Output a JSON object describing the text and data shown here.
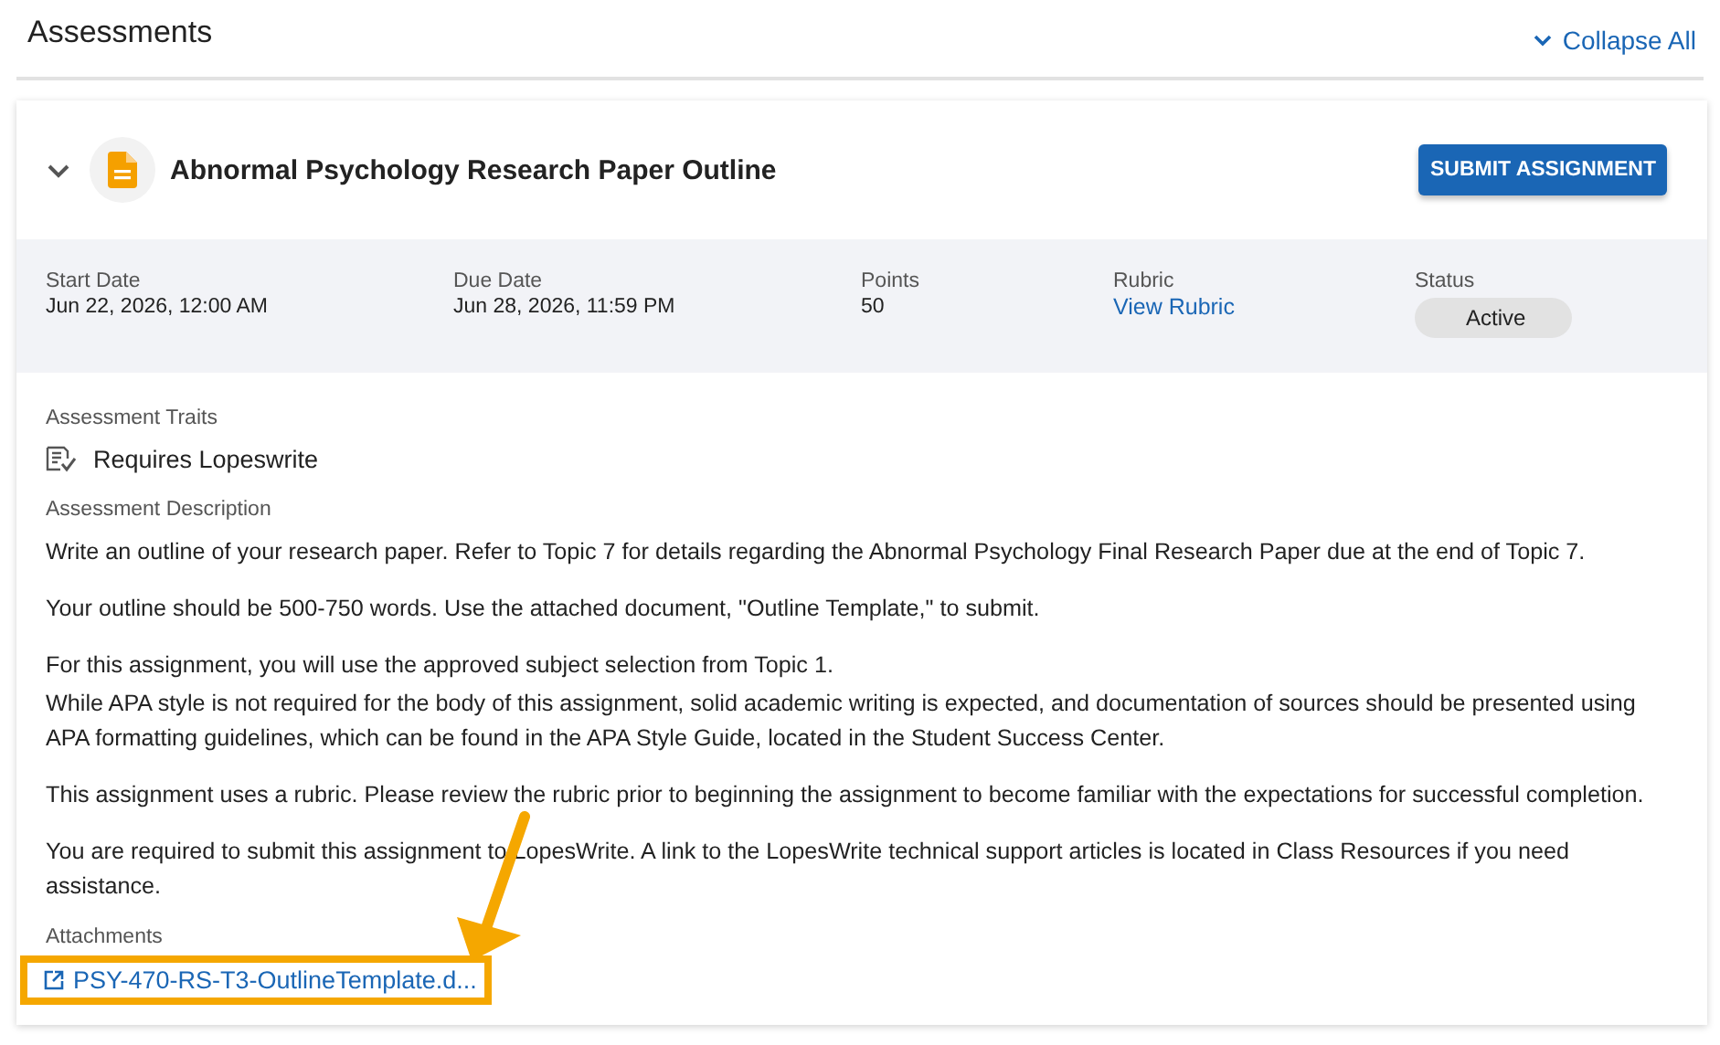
{
  "page": {
    "title": "Assessments",
    "collapse_all": "Collapse All"
  },
  "assessment": {
    "expanded": true,
    "title": "Abnormal Psychology Research Paper Outline",
    "submit_button": "SUBMIT ASSIGNMENT",
    "info": [
      {
        "label": "Start Date",
        "value": "Jun 22, 2026, 12:00 AM",
        "kind": "text"
      },
      {
        "label": "Due Date",
        "value": "Jun 28, 2026, 11:59 PM",
        "kind": "text"
      },
      {
        "label": "Points",
        "value": "50",
        "kind": "text"
      },
      {
        "label": "Rubric",
        "value": "View Rubric",
        "kind": "link"
      },
      {
        "label": "Status",
        "value": "Active",
        "kind": "badge"
      }
    ],
    "traits_label": "Assessment Traits",
    "traits": [
      "Requires Lopeswrite"
    ],
    "description_label": "Assessment Description",
    "description": [
      "Write an outline of your research paper. Refer to Topic 7 for details regarding the Abnormal Psychology Final Research Paper due at the end of Topic 7.",
      "Your outline should be 500-750 words. Use the attached document, \"Outline Template,\" to submit.",
      "For this assignment, you will use the approved subject selection from Topic 1.",
      "While APA style is not required for the body of this assignment, solid academic writing is expected, and documentation of sources should be presented using APA formatting guidelines, which can be found in the APA Style Guide, located in the Student Success Center.",
      "This assignment uses a rubric. Please review the rubric prior to beginning the assignment to become familiar with the expectations for successful completion.",
      "You are required to submit this assignment to LopesWrite. A link to the LopesWrite technical support articles is located in Class Resources if you need assistance."
    ],
    "attachments_label": "Attachments",
    "attachments": [
      "PSY-470-RS-T3-OutlineTemplate.d..."
    ]
  }
}
